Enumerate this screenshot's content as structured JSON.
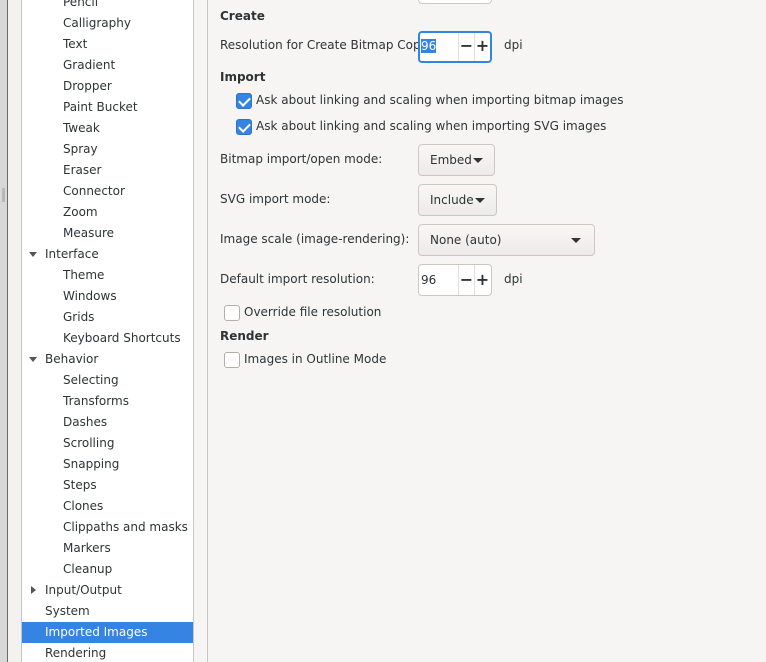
{
  "sidebar": {
    "items": [
      {
        "label": "Pencil",
        "level": 1
      },
      {
        "label": "Calligraphy",
        "level": 1
      },
      {
        "label": "Text",
        "level": 1
      },
      {
        "label": "Gradient",
        "level": 1
      },
      {
        "label": "Dropper",
        "level": 1
      },
      {
        "label": "Paint Bucket",
        "level": 1
      },
      {
        "label": "Tweak",
        "level": 1
      },
      {
        "label": "Spray",
        "level": 1
      },
      {
        "label": "Eraser",
        "level": 1
      },
      {
        "label": "Connector",
        "level": 1
      },
      {
        "label": "Zoom",
        "level": 1
      },
      {
        "label": "Measure",
        "level": 1
      },
      {
        "label": "Interface",
        "level": 0,
        "expander": "expanded"
      },
      {
        "label": "Theme",
        "level": 1
      },
      {
        "label": "Windows",
        "level": 1
      },
      {
        "label": "Grids",
        "level": 1
      },
      {
        "label": "Keyboard Shortcuts",
        "level": 1
      },
      {
        "label": "Behavior",
        "level": 0,
        "expander": "expanded"
      },
      {
        "label": "Selecting",
        "level": 1
      },
      {
        "label": "Transforms",
        "level": 1
      },
      {
        "label": "Dashes",
        "level": 1
      },
      {
        "label": "Scrolling",
        "level": 1
      },
      {
        "label": "Snapping",
        "level": 1
      },
      {
        "label": "Steps",
        "level": 1
      },
      {
        "label": "Clones",
        "level": 1
      },
      {
        "label": "Clippaths and masks",
        "level": 1
      },
      {
        "label": "Markers",
        "level": 1
      },
      {
        "label": "Cleanup",
        "level": 1
      },
      {
        "label": "Input/Output",
        "level": 0,
        "expander": "collapsed"
      },
      {
        "label": "System",
        "level": 0
      },
      {
        "label": "Imported Images",
        "level": 0,
        "selected": true
      },
      {
        "label": "Rendering",
        "level": 0
      }
    ]
  },
  "create": {
    "heading": "Create",
    "resolution_label": "Resolution for Create Bitmap Copy:",
    "resolution_value": "96",
    "resolution_unit": "dpi"
  },
  "import": {
    "heading": "Import",
    "ask_bitmap_label": "Ask about linking and scaling when importing bitmap images",
    "ask_bitmap_checked": true,
    "ask_svg_label": "Ask about linking and scaling when importing SVG images",
    "ask_svg_checked": true,
    "bitmap_mode_label": "Bitmap import/open mode:",
    "bitmap_mode_value": "Embed",
    "svg_mode_label": "SVG import mode:",
    "svg_mode_value": "Include",
    "image_scale_label": "Image scale (image-rendering):",
    "image_scale_value": "None (auto)",
    "default_res_label": "Default import resolution:",
    "default_res_value": "96",
    "default_res_unit": "dpi",
    "override_label": "Override file resolution",
    "override_checked": false
  },
  "render": {
    "heading": "Render",
    "outline_label": "Images in Outline Mode",
    "outline_checked": false
  },
  "colors": {
    "accent": "#3584e4",
    "background": "#f6f5f4"
  },
  "icons": {
    "expander_expanded": "triangle-down",
    "expander_collapsed": "triangle-right",
    "dropdown": "triangle-down",
    "decrement": "minus",
    "increment": "plus",
    "check": "checkmark"
  }
}
